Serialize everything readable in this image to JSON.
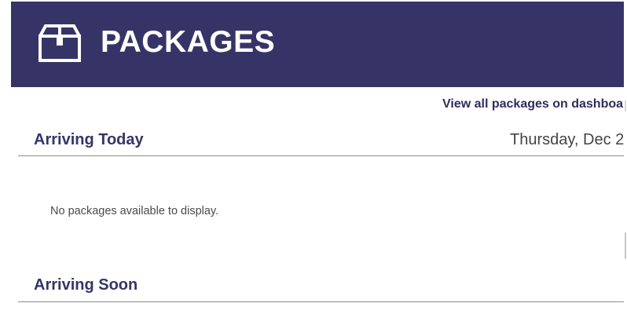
{
  "header": {
    "title": "PACKAGES",
    "icon": "package-box-icon",
    "background_color": "#363467"
  },
  "dashboard_link": {
    "label": "View all packages on dashboar"
  },
  "sections": [
    {
      "title": "Arriving Today",
      "date": "Thursday, Dec 2",
      "empty_message": "No packages available to display."
    },
    {
      "title": "Arriving Soon"
    }
  ],
  "colors": {
    "accent": "#363467",
    "divider": "#8d8d8d",
    "text_muted": "#4a4a4a"
  }
}
